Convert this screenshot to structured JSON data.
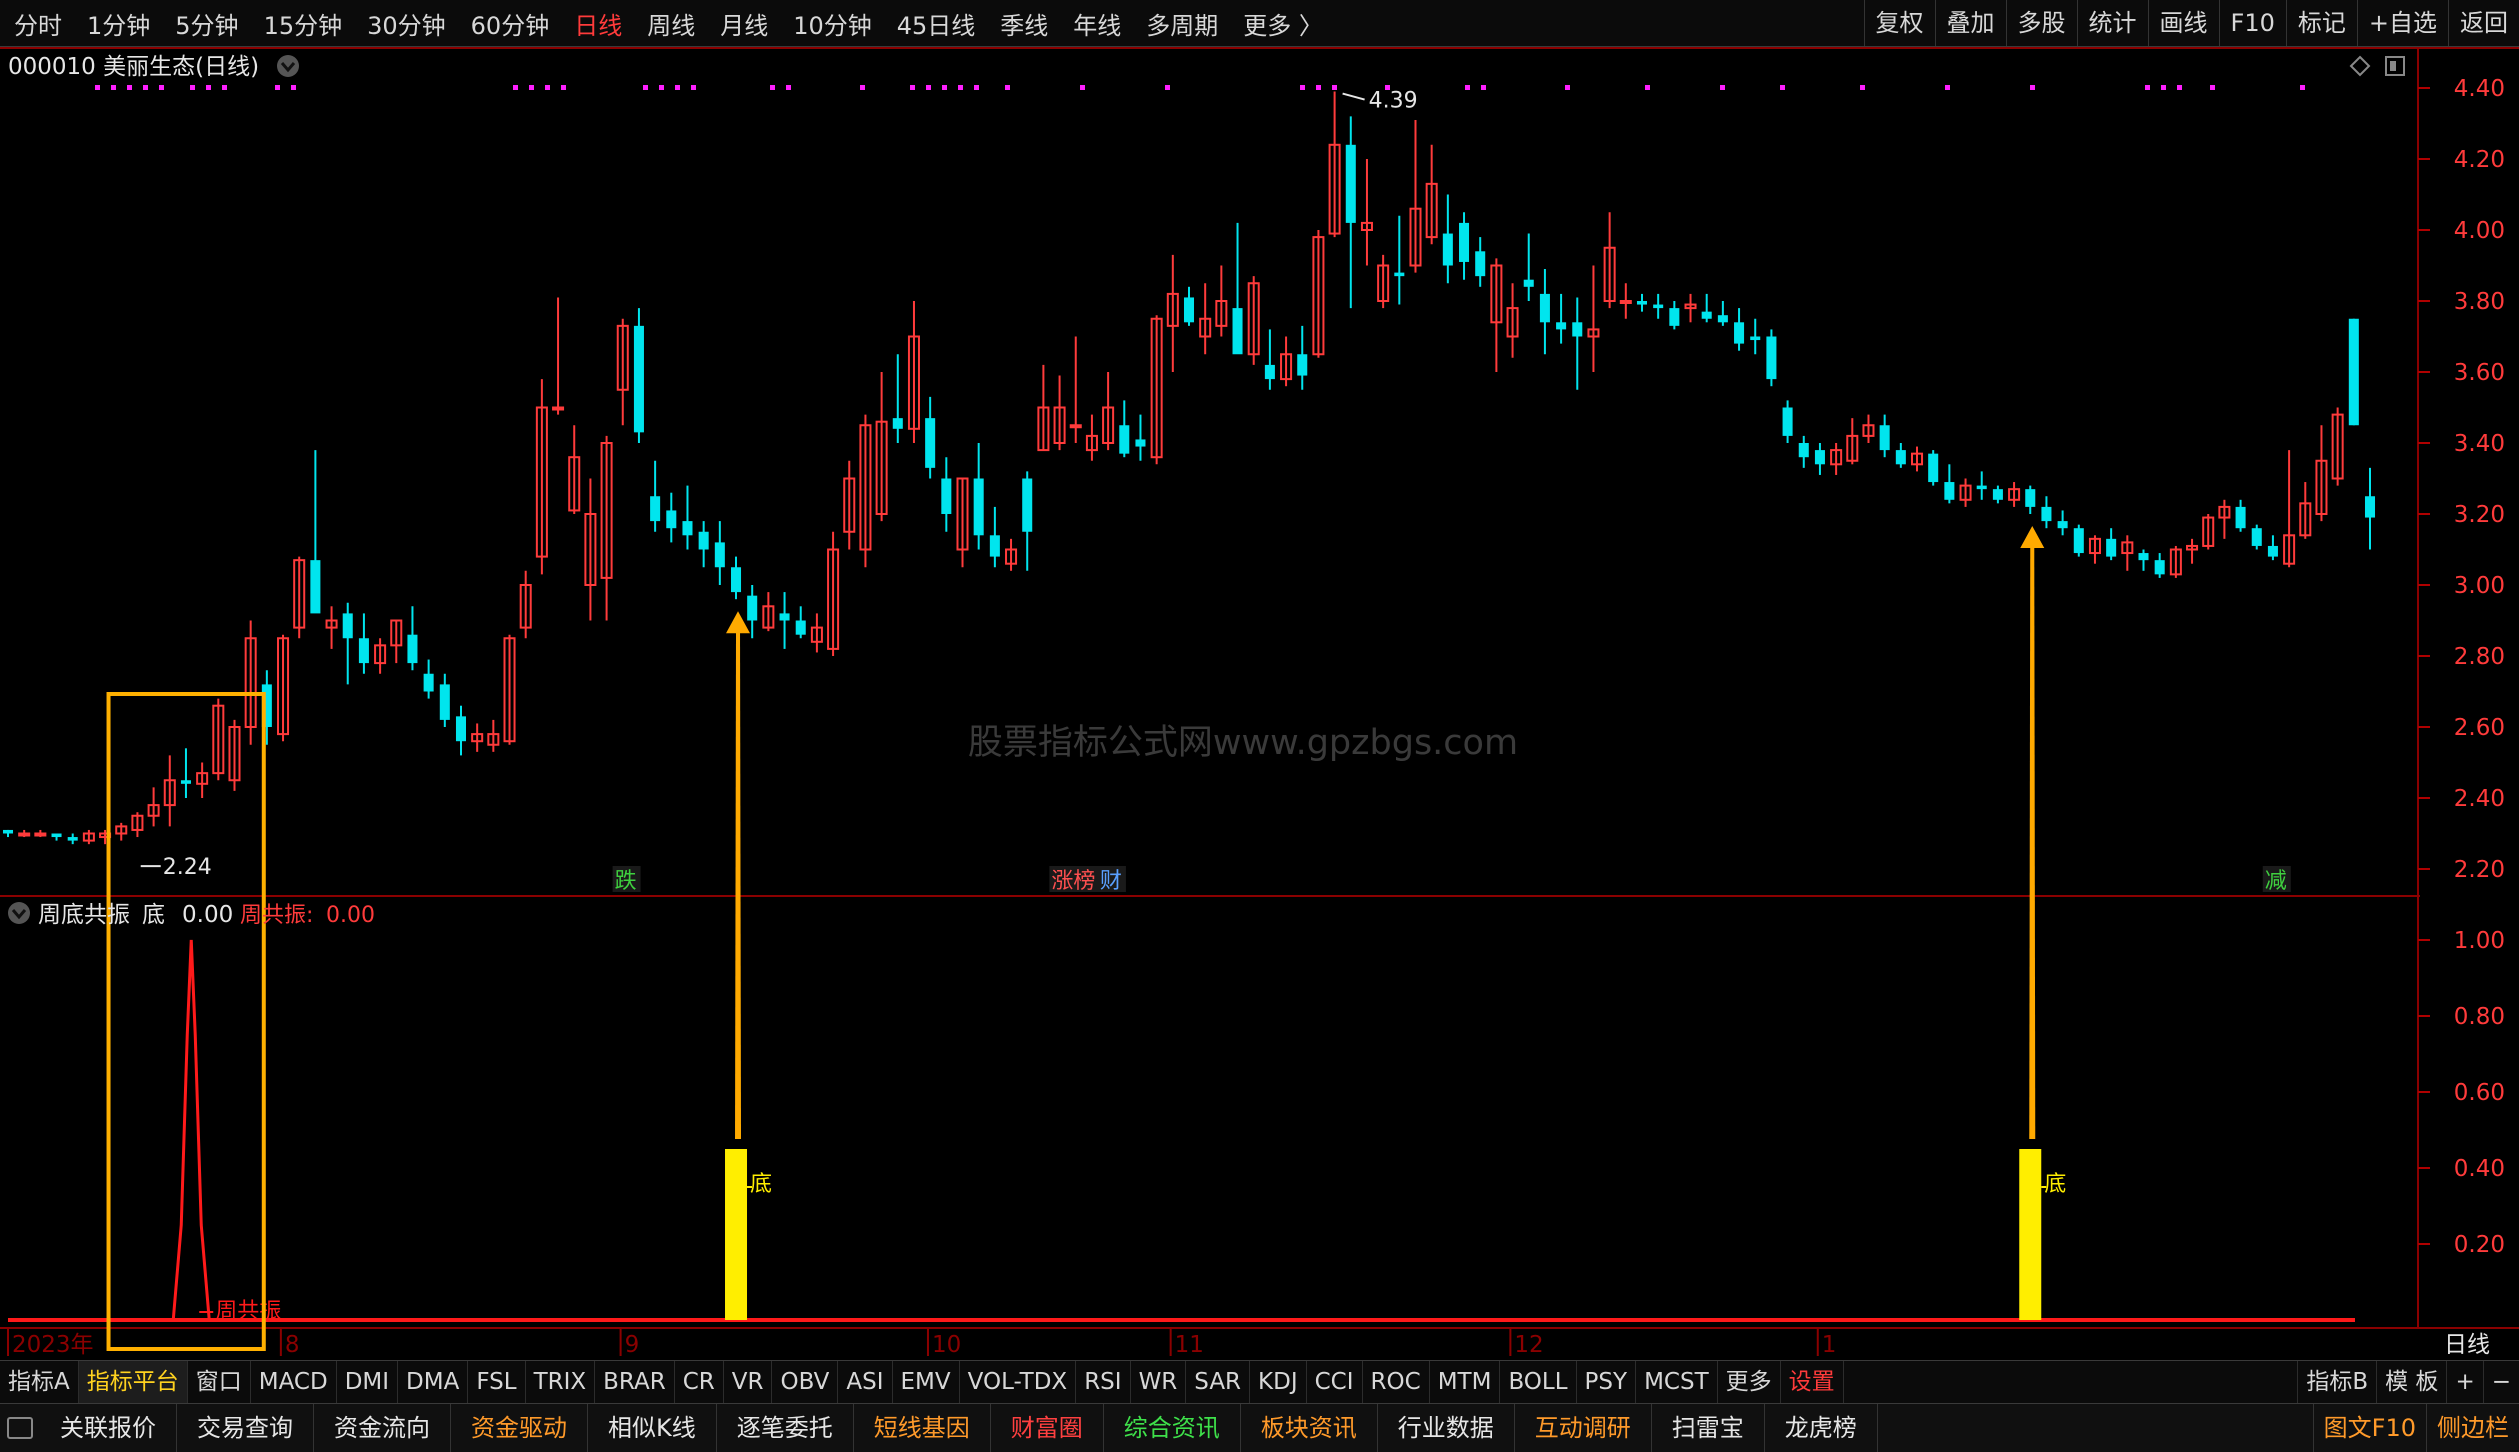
{
  "toolbar": {
    "periods": [
      "分时",
      "1分钟",
      "5分钟",
      "15分钟",
      "30分钟",
      "60分钟",
      "日线",
      "周线",
      "月线",
      "10分钟",
      "45日线",
      "季线",
      "年线",
      "多周期",
      "更多 〉"
    ],
    "active_period": "日线",
    "right_buttons": [
      "复权",
      "叠加",
      "多股",
      "统计",
      "画线",
      "F10",
      "标记",
      "+自选",
      "返回"
    ]
  },
  "stock": {
    "title": "000010 美丽生态(日线)"
  },
  "indicator": {
    "name": "周底共振",
    "label_di": "底",
    "value_di": "0.00",
    "label_zgz": "周共振:",
    "value_zgz": "0.00",
    "bar_label": "底",
    "peak_label": "周共振"
  },
  "watermark": "股票指标公式网www.gpzbgs.com",
  "annotations": {
    "high": "4.39",
    "low": "2.24"
  },
  "event_tags": [
    {
      "text": "跌",
      "index": 37,
      "color": "#3fd13f"
    },
    {
      "text": "涨榜",
      "index": 64,
      "color": "#ff5050"
    },
    {
      "text": "财",
      "index": 67,
      "color": "#5aa0ff"
    },
    {
      "text": "减",
      "index": 139,
      "color": "#3fd13f"
    }
  ],
  "indicator_tabs": [
    "指标A",
    "指标平台",
    "窗口",
    "MACD",
    "DMI",
    "DMA",
    "FSL",
    "TRIX",
    "BRAR",
    "CR",
    "VR",
    "OBV",
    "ASI",
    "EMV",
    "VOL-TDX",
    "RSI",
    "WR",
    "SAR",
    "KDJ",
    "CCI",
    "ROC",
    "MTM",
    "BOLL",
    "PSY",
    "MCST",
    "更多",
    "设置"
  ],
  "indicator_tabs_right": [
    "指标B",
    "模 板",
    "+",
    "−"
  ],
  "function_bar": [
    {
      "text": "关联报价",
      "color": "w"
    },
    {
      "text": "交易查询",
      "color": "w"
    },
    {
      "text": "资金流向",
      "color": "w"
    },
    {
      "text": "资金驱动",
      "color": "o"
    },
    {
      "text": "相似K线",
      "color": "w"
    },
    {
      "text": "逐笔委托",
      "color": "w"
    },
    {
      "text": "短线基因",
      "color": "o"
    },
    {
      "text": "财富圈",
      "color": "r"
    },
    {
      "text": "综合资讯",
      "color": "g"
    },
    {
      "text": "板块资讯",
      "color": "o"
    },
    {
      "text": "行业数据",
      "color": "w"
    },
    {
      "text": "互动调研",
      "color": "o"
    },
    {
      "text": "扫雷宝",
      "color": "w"
    },
    {
      "text": "龙虎榜",
      "color": "w"
    }
  ],
  "function_bar_right": [
    "图文F10",
    "侧边栏"
  ],
  "chart_data": {
    "type": "candlestick",
    "colors": {
      "up": "#ff3b3b",
      "down": "#00e5ee",
      "indicator": "#ff1a1a",
      "signal": "#ffee00",
      "box": "#ffb000",
      "arrow": "#ffaa00"
    },
    "price_axis": {
      "min": 2.2,
      "max": 4.4,
      "ticks": [
        "4.40",
        "4.20",
        "4.00",
        "3.80",
        "3.60",
        "3.40",
        "3.20",
        "3.00",
        "2.80",
        "2.60",
        "2.40",
        "2.20"
      ]
    },
    "indicator_axis": {
      "min": 0,
      "max": 1.0,
      "ticks": [
        "1.00",
        "0.80",
        "0.60",
        "0.40",
        "0.20"
      ]
    },
    "x_labels": [
      {
        "text": "2023年",
        "index": 0
      },
      {
        "text": "8",
        "index": 16
      },
      {
        "text": "9",
        "index": 37
      },
      {
        "text": "10",
        "index": 56
      },
      {
        "text": "11",
        "index": 71
      },
      {
        "text": "12",
        "index": 92
      },
      {
        "text": "1",
        "index": 111
      }
    ],
    "period_label": "日线",
    "candles": [
      [
        2.31,
        2.31,
        2.29,
        2.3
      ],
      [
        2.3,
        2.31,
        2.29,
        2.3
      ],
      [
        2.3,
        2.31,
        2.29,
        2.3
      ],
      [
        2.3,
        2.3,
        2.28,
        2.29
      ],
      [
        2.29,
        2.3,
        2.27,
        2.28
      ],
      [
        2.28,
        2.31,
        2.27,
        2.3
      ],
      [
        2.29,
        2.31,
        2.27,
        2.3
      ],
      [
        2.3,
        2.33,
        2.28,
        2.32
      ],
      [
        2.31,
        2.36,
        2.29,
        2.35
      ],
      [
        2.35,
        2.43,
        2.32,
        2.38
      ],
      [
        2.38,
        2.52,
        2.32,
        2.45
      ],
      [
        2.45,
        2.54,
        2.4,
        2.44
      ],
      [
        2.44,
        2.5,
        2.4,
        2.47
      ],
      [
        2.47,
        2.68,
        2.45,
        2.66
      ],
      [
        2.45,
        2.62,
        2.42,
        2.6
      ],
      [
        2.6,
        2.9,
        2.55,
        2.85
      ],
      [
        2.72,
        2.76,
        2.55,
        2.6
      ],
      [
        2.58,
        2.86,
        2.56,
        2.85
      ],
      [
        2.88,
        3.08,
        2.85,
        3.07
      ],
      [
        3.07,
        3.38,
        2.95,
        2.92
      ],
      [
        2.88,
        2.94,
        2.82,
        2.9
      ],
      [
        2.92,
        2.95,
        2.72,
        2.85
      ],
      [
        2.85,
        2.92,
        2.75,
        2.78
      ],
      [
        2.78,
        2.85,
        2.75,
        2.83
      ],
      [
        2.83,
        2.9,
        2.78,
        2.9
      ],
      [
        2.86,
        2.94,
        2.76,
        2.78
      ],
      [
        2.75,
        2.79,
        2.68,
        2.7
      ],
      [
        2.72,
        2.75,
        2.6,
        2.62
      ],
      [
        2.63,
        2.66,
        2.52,
        2.56
      ],
      [
        2.56,
        2.61,
        2.53,
        2.58
      ],
      [
        2.55,
        2.62,
        2.53,
        2.58
      ],
      [
        2.56,
        2.86,
        2.55,
        2.85
      ],
      [
        2.88,
        3.04,
        2.85,
        3.0
      ],
      [
        3.08,
        3.58,
        3.03,
        3.5
      ],
      [
        3.5,
        3.81,
        3.48,
        3.5
      ],
      [
        3.21,
        3.45,
        3.2,
        3.36
      ],
      [
        3.0,
        3.3,
        2.9,
        3.2
      ],
      [
        3.02,
        3.42,
        2.9,
        3.4
      ],
      [
        3.55,
        3.75,
        3.45,
        3.73
      ],
      [
        3.73,
        3.78,
        3.4,
        3.43
      ],
      [
        3.25,
        3.35,
        3.15,
        3.18
      ],
      [
        3.21,
        3.26,
        3.12,
        3.16
      ],
      [
        3.18,
        3.28,
        3.1,
        3.14
      ],
      [
        3.15,
        3.18,
        3.05,
        3.1
      ],
      [
        3.12,
        3.18,
        3.0,
        3.05
      ],
      [
        3.05,
        3.08,
        2.96,
        2.98
      ],
      [
        2.97,
        3.0,
        2.85,
        2.9
      ],
      [
        2.88,
        2.98,
        2.87,
        2.94
      ],
      [
        2.92,
        2.98,
        2.82,
        2.9
      ],
      [
        2.9,
        2.94,
        2.85,
        2.86
      ],
      [
        2.84,
        2.92,
        2.81,
        2.88
      ],
      [
        2.82,
        3.15,
        2.8,
        3.1
      ],
      [
        3.15,
        3.35,
        3.1,
        3.3
      ],
      [
        3.1,
        3.48,
        3.05,
        3.45
      ],
      [
        3.2,
        3.6,
        3.18,
        3.46
      ],
      [
        3.47,
        3.65,
        3.4,
        3.44
      ],
      [
        3.44,
        3.8,
        3.4,
        3.7
      ],
      [
        3.47,
        3.53,
        3.3,
        3.33
      ],
      [
        3.3,
        3.36,
        3.15,
        3.2
      ],
      [
        3.1,
        3.3,
        3.05,
        3.3
      ],
      [
        3.3,
        3.4,
        3.1,
        3.14
      ],
      [
        3.14,
        3.22,
        3.05,
        3.08
      ],
      [
        3.06,
        3.13,
        3.04,
        3.1
      ],
      [
        3.3,
        3.32,
        3.04,
        3.15
      ],
      [
        3.38,
        3.62,
        3.38,
        3.5
      ],
      [
        3.4,
        3.59,
        3.38,
        3.5
      ],
      [
        3.45,
        3.7,
        3.4,
        3.45
      ],
      [
        3.38,
        3.48,
        3.35,
        3.42
      ],
      [
        3.4,
        3.6,
        3.38,
        3.5
      ],
      [
        3.45,
        3.52,
        3.36,
        3.37
      ],
      [
        3.41,
        3.48,
        3.35,
        3.39
      ],
      [
        3.36,
        3.76,
        3.34,
        3.75
      ],
      [
        3.73,
        3.93,
        3.6,
        3.82
      ],
      [
        3.81,
        3.84,
        3.73,
        3.74
      ],
      [
        3.7,
        3.85,
        3.65,
        3.75
      ],
      [
        3.73,
        3.9,
        3.7,
        3.8
      ],
      [
        3.78,
        4.02,
        3.75,
        3.65
      ],
      [
        3.65,
        3.87,
        3.62,
        3.85
      ],
      [
        3.62,
        3.72,
        3.55,
        3.58
      ],
      [
        3.58,
        3.7,
        3.56,
        3.65
      ],
      [
        3.65,
        3.73,
        3.55,
        3.59
      ],
      [
        3.65,
        4.0,
        3.64,
        3.98
      ],
      [
        3.99,
        4.39,
        3.98,
        4.24
      ],
      [
        4.24,
        4.32,
        3.78,
        4.02
      ],
      [
        4.0,
        4.2,
        3.9,
        4.02
      ],
      [
        3.8,
        3.93,
        3.78,
        3.9
      ],
      [
        3.88,
        4.04,
        3.79,
        3.87
      ],
      [
        3.9,
        4.31,
        3.88,
        4.06
      ],
      [
        3.98,
        4.24,
        3.96,
        4.13
      ],
      [
        3.99,
        4.1,
        3.85,
        3.9
      ],
      [
        4.02,
        4.05,
        3.86,
        3.91
      ],
      [
        3.94,
        3.98,
        3.84,
        3.87
      ],
      [
        3.74,
        3.92,
        3.6,
        3.9
      ],
      [
        3.7,
        3.85,
        3.64,
        3.78
      ],
      [
        3.86,
        3.99,
        3.8,
        3.84
      ],
      [
        3.82,
        3.89,
        3.65,
        3.74
      ],
      [
        3.74,
        3.82,
        3.68,
        3.72
      ],
      [
        3.74,
        3.81,
        3.55,
        3.7
      ],
      [
        3.7,
        3.9,
        3.6,
        3.72
      ],
      [
        3.8,
        4.05,
        3.78,
        3.95
      ],
      [
        3.8,
        3.85,
        3.75,
        3.8
      ],
      [
        3.8,
        3.82,
        3.77,
        3.79
      ],
      [
        3.79,
        3.82,
        3.75,
        3.78
      ],
      [
        3.78,
        3.8,
        3.72,
        3.73
      ],
      [
        3.78,
        3.82,
        3.74,
        3.79
      ],
      [
        3.77,
        3.82,
        3.74,
        3.75
      ],
      [
        3.76,
        3.8,
        3.73,
        3.74
      ],
      [
        3.74,
        3.78,
        3.66,
        3.68
      ],
      [
        3.7,
        3.75,
        3.65,
        3.69
      ],
      [
        3.7,
        3.72,
        3.56,
        3.58
      ],
      [
        3.5,
        3.52,
        3.4,
        3.42
      ],
      [
        3.4,
        3.42,
        3.33,
        3.36
      ],
      [
        3.38,
        3.4,
        3.31,
        3.34
      ],
      [
        3.34,
        3.4,
        3.31,
        3.38
      ],
      [
        3.35,
        3.47,
        3.34,
        3.42
      ],
      [
        3.42,
        3.48,
        3.4,
        3.45
      ],
      [
        3.45,
        3.48,
        3.36,
        3.38
      ],
      [
        3.38,
        3.4,
        3.33,
        3.34
      ],
      [
        3.34,
        3.39,
        3.32,
        3.37
      ],
      [
        3.37,
        3.38,
        3.28,
        3.29
      ],
      [
        3.29,
        3.34,
        3.23,
        3.24
      ],
      [
        3.24,
        3.3,
        3.22,
        3.28
      ],
      [
        3.28,
        3.32,
        3.24,
        3.27
      ],
      [
        3.27,
        3.28,
        3.23,
        3.24
      ],
      [
        3.24,
        3.29,
        3.22,
        3.27
      ],
      [
        3.27,
        3.28,
        3.2,
        3.22
      ],
      [
        3.22,
        3.25,
        3.16,
        3.18
      ],
      [
        3.18,
        3.21,
        3.14,
        3.16
      ],
      [
        3.16,
        3.17,
        3.08,
        3.09
      ],
      [
        3.09,
        3.14,
        3.06,
        3.13
      ],
      [
        3.13,
        3.16,
        3.07,
        3.08
      ],
      [
        3.09,
        3.14,
        3.04,
        3.12
      ],
      [
        3.09,
        3.1,
        3.04,
        3.07
      ],
      [
        3.07,
        3.09,
        3.02,
        3.03
      ],
      [
        3.03,
        3.11,
        3.02,
        3.1
      ],
      [
        3.1,
        3.13,
        3.06,
        3.11
      ],
      [
        3.11,
        3.2,
        3.1,
        3.19
      ],
      [
        3.19,
        3.24,
        3.13,
        3.22
      ],
      [
        3.22,
        3.24,
        3.15,
        3.16
      ],
      [
        3.16,
        3.17,
        3.1,
        3.11
      ],
      [
        3.11,
        3.14,
        3.07,
        3.08
      ],
      [
        3.06,
        3.38,
        3.05,
        3.14
      ],
      [
        3.14,
        3.29,
        3.13,
        3.23
      ],
      [
        3.2,
        3.45,
        3.18,
        3.35
      ],
      [
        3.3,
        3.5,
        3.28,
        3.48
      ],
      [
        3.75,
        3.75,
        3.45,
        3.45
      ],
      [
        3.25,
        3.33,
        3.1,
        3.19
      ]
    ],
    "di_signals": [
      {
        "index": 45,
        "value": 0.45
      },
      {
        "index": 125,
        "value": 0.45
      }
    ],
    "resonance_peak": {
      "index": 7,
      "value": 1.0
    },
    "highlight_box_index_range": [
      3,
      10
    ]
  }
}
